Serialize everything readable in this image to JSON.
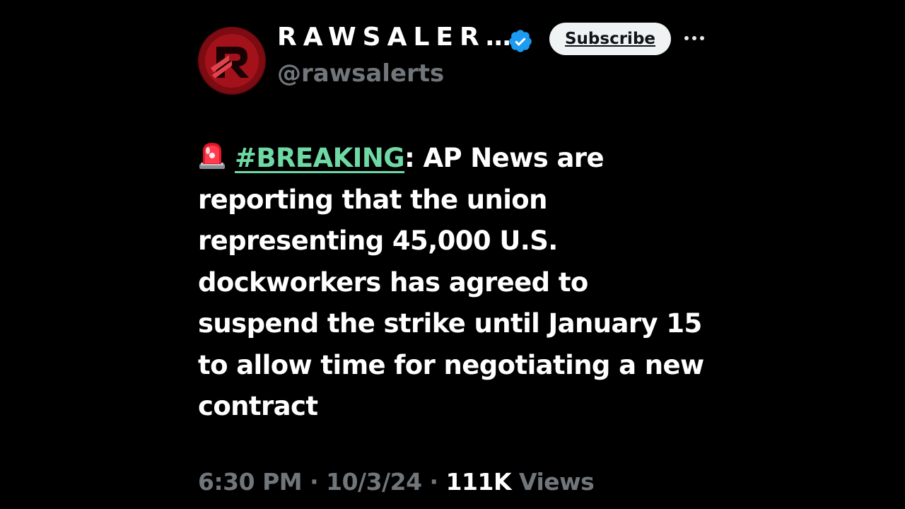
{
  "author": {
    "display_name": "RAWSALER…",
    "handle": "@rawsalerts",
    "verified": true,
    "avatar_icon": "rawsalerts-logo",
    "avatar_color": "#b3121c"
  },
  "actions": {
    "subscribe_label": "Subscribe",
    "more_icon": "more-horizontal-icon"
  },
  "post": {
    "emoji_icon": "police-siren-icon",
    "hashtag": "#BREAKING",
    "text_after_hashtag": ": AP News are reporting that the union representing 45,000 U.S. dockworkers has agreed to suspend the strike until January 15 to allow time for negotiating a new contract"
  },
  "meta": {
    "time": "6:30 PM",
    "separator": " · ",
    "date": "10/3/24",
    "views_count": "111K",
    "views_label": "Views"
  },
  "colors": {
    "background": "#000000",
    "text": "#ffffff",
    "secondary_text": "#71767b",
    "hashtag": "#6fd9a4",
    "verified_badge": "#1d9bf0"
  }
}
